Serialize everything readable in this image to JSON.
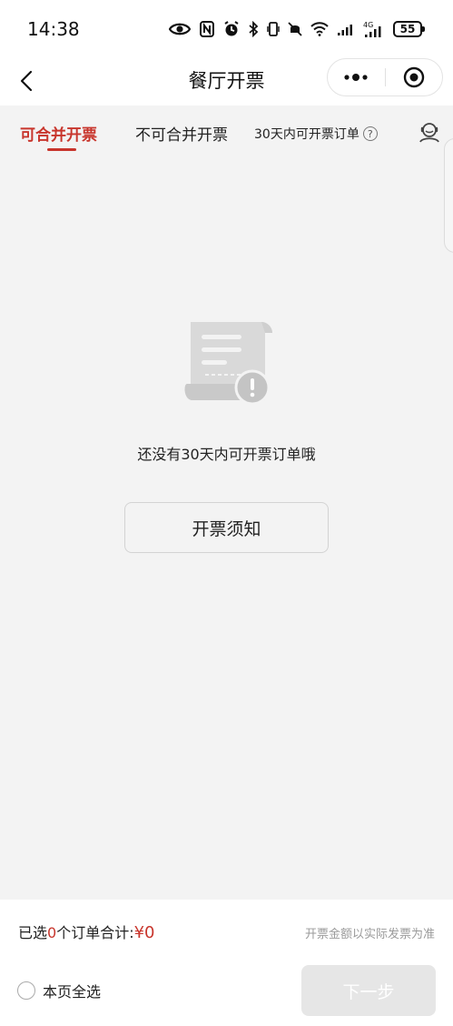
{
  "status_bar": {
    "time": "14:38",
    "battery": "55",
    "network": "4G",
    "icons": [
      "eye-icon",
      "nfc-icon",
      "alarm-icon",
      "bluetooth-icon",
      "vibrate-icon",
      "mute-icon",
      "wifi-icon",
      "signal-icon",
      "signal-4g-icon",
      "battery-icon"
    ]
  },
  "nav": {
    "title": "餐厅开票",
    "icons": [
      "back-arrow-icon",
      "more-dots-icon",
      "target-close-icon"
    ]
  },
  "tabs": [
    {
      "label": "可合并开票",
      "active": true
    },
    {
      "label": "不可合并开票",
      "active": false
    },
    {
      "label": "30天内可开票订单",
      "active": false,
      "help": "?"
    }
  ],
  "empty_state": {
    "icon": "document-warning-icon",
    "message": "还没有30天内可开票订单哦",
    "button_label": "开票须知"
  },
  "footer": {
    "selected_prefix": "已选",
    "selected_count": "0",
    "selected_suffix": "个订单合计:",
    "total": "¥0",
    "note": "开票金额以实际发票为准",
    "select_all_label": "本页全选",
    "next_label": "下一步"
  },
  "colors": {
    "accent": "#c8352c",
    "background": "#f3f3f3",
    "disabled_button": "#e6e6e6"
  }
}
